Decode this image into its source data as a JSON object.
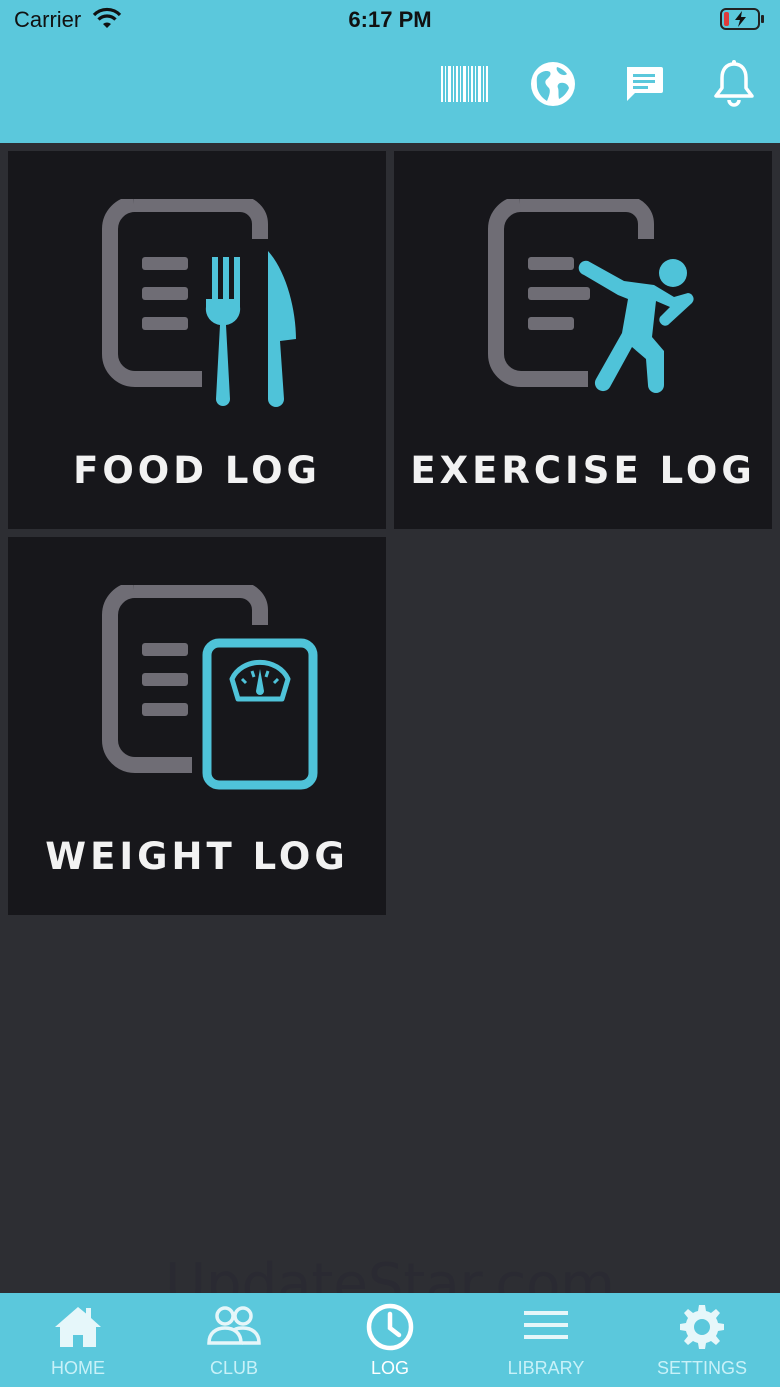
{
  "status": {
    "carrier": "Carrier",
    "time": "6:17 PM"
  },
  "header": {
    "actions": [
      {
        "icon": "barcode-icon"
      },
      {
        "icon": "globe-icon"
      },
      {
        "icon": "message-icon"
      },
      {
        "icon": "bell-icon"
      }
    ]
  },
  "tiles": [
    {
      "label": "FOOD LOG",
      "icon": "food-log-icon"
    },
    {
      "label": "EXERCISE LOG",
      "icon": "exercise-log-icon"
    },
    {
      "label": "WEIGHT LOG",
      "icon": "weight-log-icon"
    }
  ],
  "tabs": [
    {
      "label": "HOME",
      "icon": "home-icon"
    },
    {
      "label": "CLUB",
      "icon": "club-icon"
    },
    {
      "label": "LOG",
      "icon": "clock-icon",
      "active": true
    },
    {
      "label": "LIBRARY",
      "icon": "library-icon"
    },
    {
      "label": "SETTINGS",
      "icon": "gear-icon"
    }
  ],
  "watermark": "UpdateStar.com",
  "colors": {
    "accent": "#5bc8dc",
    "tile_bg": "#17171b",
    "page_bg": "#2d2e33",
    "icon_gray": "#6f6d75",
    "icon_blue": "#4fc3d9"
  }
}
